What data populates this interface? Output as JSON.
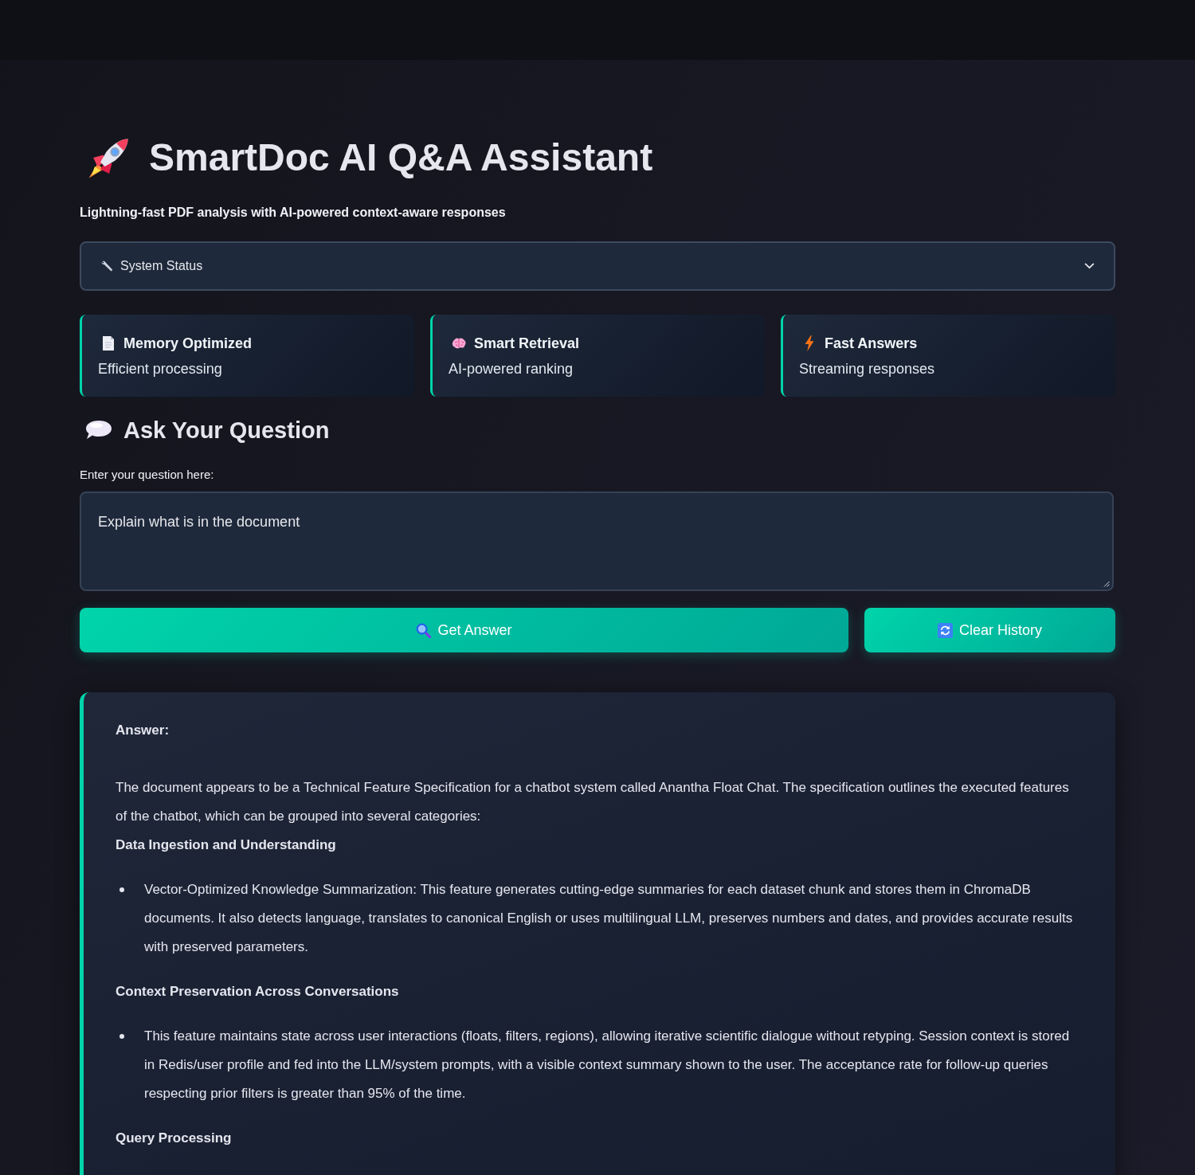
{
  "header": {
    "title": "SmartDoc AI Q&A Assistant",
    "subtitle": "Lightning-fast PDF analysis with AI-powered context-aware responses"
  },
  "system_status": {
    "label": "System Status",
    "expanded": false
  },
  "features": [
    {
      "title": "Memory Optimized",
      "description": "Efficient processing"
    },
    {
      "title": "Smart Retrieval",
      "description": "AI-powered ranking"
    },
    {
      "title": "Fast Answers",
      "description": "Streaming responses"
    }
  ],
  "question": {
    "heading": "Ask Your Question",
    "field_label": "Enter your question here:",
    "value": "Explain what is in the document"
  },
  "buttons": [
    {
      "label": "Get Answer"
    },
    {
      "label": "Clear History"
    }
  ],
  "answer": {
    "label": "Answer:",
    "blocks": [
      {
        "kind": "paragraph",
        "text": "The document appears to be a Technical Feature Specification for a chatbot system called Anantha Float Chat. The specification outlines the executed features of the chatbot, which can be grouped into several categories:"
      },
      {
        "kind": "heading",
        "text": "Data Ingestion and Understanding"
      },
      {
        "kind": "list",
        "items": [
          "Vector-Optimized Knowledge Summarization: This feature generates cutting-edge summaries for each dataset chunk and stores them in ChromaDB documents. It also detects language, translates to canonical English or uses multilingual LLM, preserves numbers and dates, and provides accurate results with preserved parameters."
        ]
      },
      {
        "kind": "heading",
        "text": "Context Preservation Across Conversations"
      },
      {
        "kind": "list",
        "items": [
          "This feature maintains state across user interactions (floats, filters, regions), allowing iterative scientific dialogue without retyping. Session context is stored in Redis/user profile and fed into the LLM/system prompts, with a visible context summary shown to the user. The acceptance rate for follow-up queries respecting prior filters is greater than 95% of the time."
        ]
      },
      {
        "kind": "heading",
        "text": "Query Processing"
      }
    ]
  }
}
